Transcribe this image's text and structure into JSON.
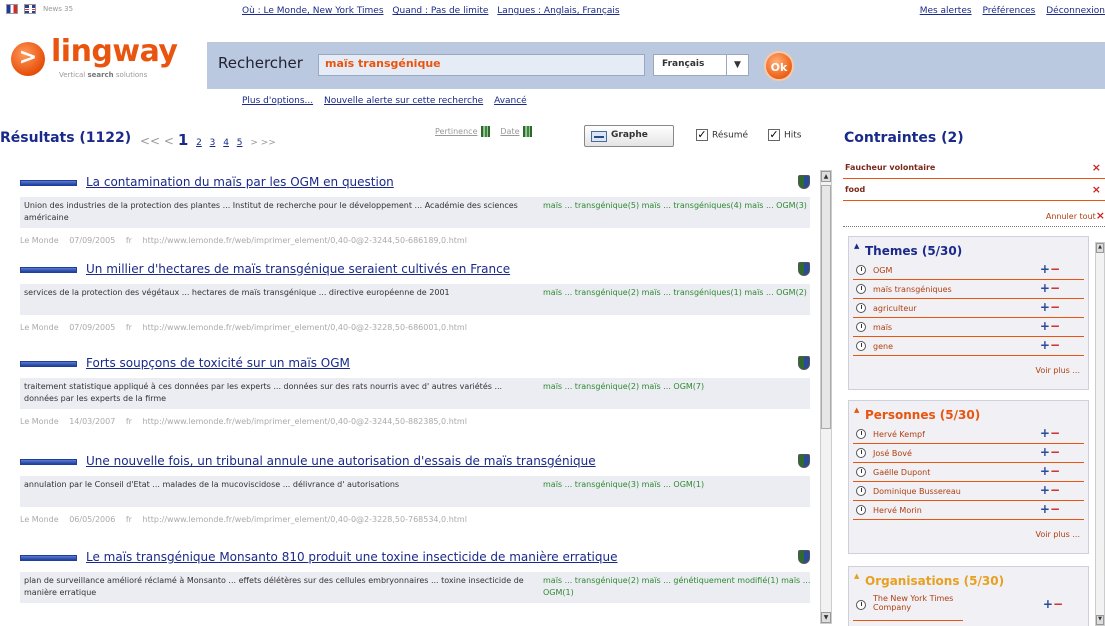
{
  "header": {
    "news_label": "News 35",
    "where_links": [
      "Où : Le Monde, New York Times",
      "Quand : Pas de limite",
      "Langues : Anglais, Français"
    ],
    "user_links": [
      "Mes alertes",
      "Préférences",
      "Déconnexion"
    ],
    "logo_text": "lingway",
    "logo_symbol": ">",
    "logo_tagline_pre": "Vertical ",
    "logo_tagline_bold": "search",
    "logo_tagline_post": " solutions"
  },
  "search": {
    "label": "Rechercher",
    "query": "maïs transgénique",
    "language": "Français",
    "language_arrow": "▼",
    "submit_label": "Ok"
  },
  "options_links": [
    "Plus d'options...",
    "Nouvelle alerte sur cette recherche",
    "Avancé"
  ],
  "results_header": {
    "title": "Résultats (1122)",
    "pager_prev": "<< <",
    "current_page": "1",
    "pages": [
      "2",
      "3",
      "4",
      "5"
    ],
    "pager_next": "> >>",
    "sort_relevance": "Pertinence",
    "sort_date": "Date",
    "graph_label": "Graphe",
    "resume_label": "Résumé",
    "hits_label": "Hits",
    "resume_checked": true,
    "hits_checked": true,
    "check_glyph": "✓"
  },
  "results": [
    {
      "title": "La contamination du maïs par les OGM en question",
      "snippet": "Union des industries de la protection des plantes ... Institut de recherche pour le développement ... Académie des sciences américaine",
      "hits": "maïs ... transgénique(5) maïs ... transgéniques(4) maïs ... OGM(3)",
      "source": "Le Monde",
      "date": "07/09/2005",
      "lang": "fr",
      "url": "http://www.lemonde.fr/web/imprimer_element/0,40-0@2-3244,50-686189,0.html"
    },
    {
      "title": "Un millier d'hectares de maïs transgénique seraient cultivés en France",
      "snippet": "services de la protection des végétaux ... hectares de maïs transgénique ... directive européenne de 2001",
      "hits": "maïs ... transgénique(2) maïs ... transgéniques(1) maïs ... OGM(2)",
      "source": "Le Monde",
      "date": "07/09/2005",
      "lang": "fr",
      "url": "http://www.lemonde.fr/web/imprimer_element/0,40-0@2-3228,50-686001,0.html"
    },
    {
      "title": "Forts soupçons de toxicité sur un maïs OGM",
      "snippet": "traitement statistique appliqué à ces données par les experts ... données sur des rats nourris avec d' autres variétés ... données par les experts de la firme",
      "hits": "maïs ... transgénique(2) maïs ... OGM(7)",
      "source": "Le Monde",
      "date": "14/03/2007",
      "lang": "fr",
      "url": "http://www.lemonde.fr/web/imprimer_element/0,40-0@2-3244,50-882385,0.html"
    },
    {
      "title": "Une nouvelle fois, un tribunal annule une autorisation d'essais de maïs transgénique",
      "snippet": "annulation par le Conseil d'Etat ... malades de la mucoviscidose ... délivrance d' autorisations",
      "hits": "maïs ... transgénique(3) maïs ... OGM(1)",
      "source": "Le Monde",
      "date": "06/05/2006",
      "lang": "fr",
      "url": "http://www.lemonde.fr/web/imprimer_element/0,40-0@2-3228,50-768534,0.html"
    },
    {
      "title": "Le maïs transgénique Monsanto 810 produit une toxine insecticide de manière erratique",
      "snippet": "plan de surveillance amélioré réclamé à Monsanto ... effets délétères sur des cellules embryonnaires ... toxine insecticide de manière erratique",
      "hits": "maïs ... transgénique(2) maïs ... génétiquement modifié(1) maïs ... OGM(1)",
      "source": "",
      "date": "",
      "lang": "",
      "url": ""
    }
  ],
  "constraints": {
    "title": "Contraintes (2)",
    "items": [
      "Faucheur volontaire",
      "food"
    ],
    "remove_glyph": "×",
    "cancel_all": "Annuler tout"
  },
  "facets": [
    {
      "title": "Themes (5/30)",
      "items": [
        "OGM",
        "maïs transgéniques",
        "agriculteur",
        "maïs",
        "gene"
      ],
      "more": "Voir plus ..."
    },
    {
      "title": "Personnes (5/30)",
      "items": [
        "Hervé Kempf",
        "José Bové",
        "Gaëlle Dupont",
        "Dominique Bussereau",
        "Hervé Morin"
      ],
      "more": "Voir plus ..."
    },
    {
      "title": "Organisations (5/30)",
      "items": [
        "The New York Times Company"
      ],
      "more": ""
    }
  ],
  "colors": {
    "accent_orange": "#e9540f",
    "link_blue": "#1a2a8a",
    "hits_green": "#2e8b2e",
    "organisations_title": "#e8a020",
    "personnes_title": "#e9540f",
    "themes_title": "#1a2a8a"
  },
  "icons": {
    "plus": "+",
    "minus": "−",
    "scroll_up": "▲",
    "scroll_down": "▼",
    "facet_triangle": "▲"
  }
}
